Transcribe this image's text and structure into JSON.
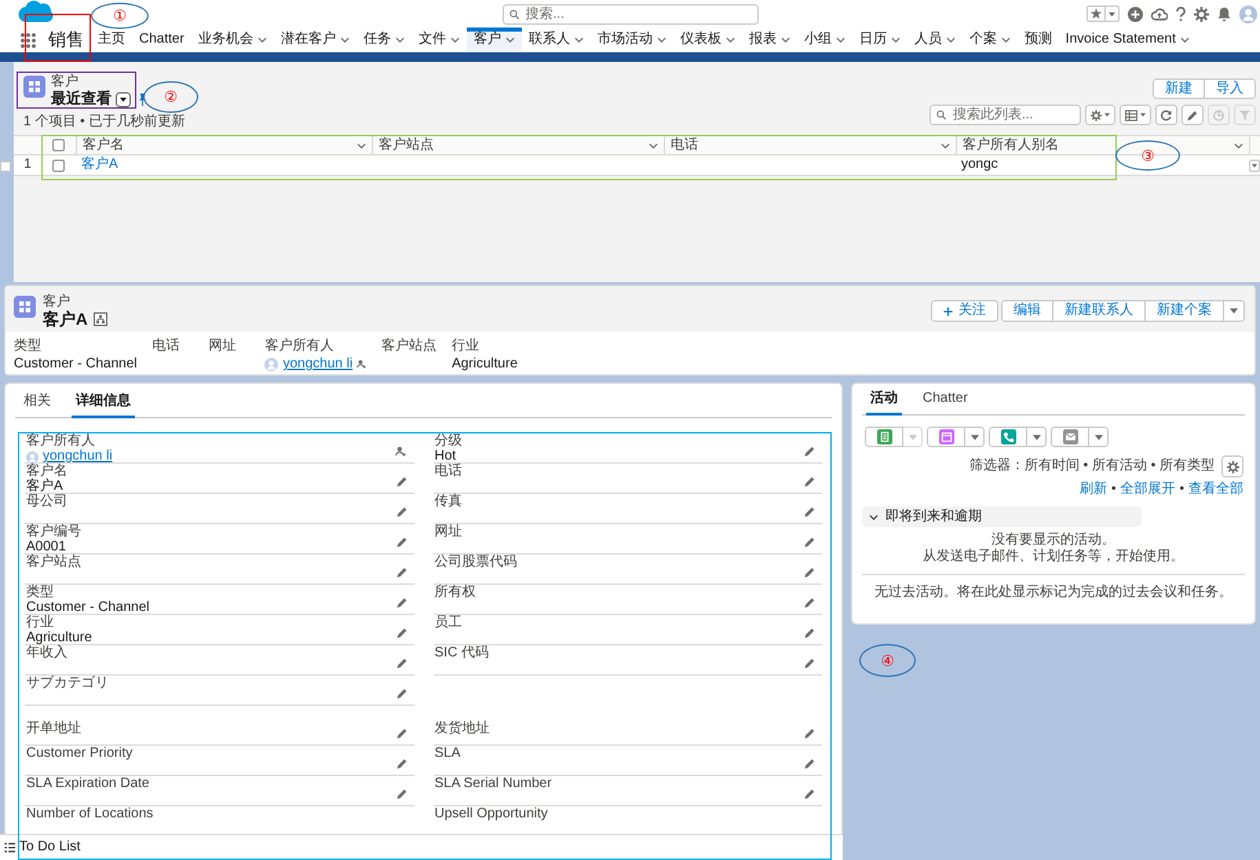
{
  "header": {
    "search": {
      "placeholder": "搜索..."
    }
  },
  "app": {
    "name": "销售"
  },
  "nav": [
    {
      "label": "主页",
      "has_menu": false,
      "selected": false
    },
    {
      "label": "Chatter",
      "has_menu": false,
      "selected": false
    },
    {
      "label": "业务机会",
      "has_menu": true,
      "selected": false
    },
    {
      "label": "潜在客户",
      "has_menu": true,
      "selected": false
    },
    {
      "label": "任务",
      "has_menu": true,
      "selected": false
    },
    {
      "label": "文件",
      "has_menu": true,
      "selected": false
    },
    {
      "label": "客户",
      "has_menu": true,
      "selected": true
    },
    {
      "label": "联系人",
      "has_menu": true,
      "selected": false
    },
    {
      "label": "市场活动",
      "has_menu": true,
      "selected": false
    },
    {
      "label": "仪表板",
      "has_menu": true,
      "selected": false
    },
    {
      "label": "报表",
      "has_menu": true,
      "selected": false
    },
    {
      "label": "小组",
      "has_menu": true,
      "selected": false
    },
    {
      "label": "日历",
      "has_menu": true,
      "selected": false
    },
    {
      "label": "人员",
      "has_menu": true,
      "selected": false
    },
    {
      "label": "个案",
      "has_menu": true,
      "selected": false
    },
    {
      "label": "预测",
      "has_menu": false,
      "selected": false
    },
    {
      "label": "Invoice Statement",
      "has_menu": true,
      "selected": false
    }
  ],
  "list_view": {
    "object_label": "客户",
    "title": "最近查看",
    "status": "1 个项目 • 已于几秒前更新",
    "buttons": [
      "新建",
      "导入"
    ],
    "search": {
      "placeholder": "搜索此列表..."
    },
    "table": {
      "select_all_checked": false,
      "columns": [
        "客户名",
        "客户站点",
        "电话",
        "客户所有人别名"
      ],
      "rows": [
        {
          "number": "1",
          "checked": false,
          "name": "客户A",
          "owner_alias": "yongc"
        }
      ]
    }
  },
  "record": {
    "object_label": "客户",
    "name": "客户A",
    "buttons": [
      {
        "label": "关注",
        "kind": "follow"
      },
      {
        "label": "编辑",
        "kind": "plain"
      },
      {
        "label": "新建联系人",
        "kind": "plain"
      },
      {
        "label": "新建个案",
        "kind": "plain"
      }
    ],
    "highlights": [
      {
        "label": "类型",
        "value": "Customer - Channel",
        "kind": "text"
      },
      {
        "label": "电话",
        "kind": "text"
      },
      {
        "label": "网址",
        "kind": "text"
      },
      {
        "label": "客户所有人",
        "value": "yongchun li",
        "kind": "user"
      },
      {
        "label": "客户站点",
        "kind": "text"
      },
      {
        "label": "行业",
        "value": "Agriculture",
        "kind": "text"
      }
    ]
  },
  "detail": {
    "tabs": [
      {
        "label": "相关",
        "selected": false
      },
      {
        "label": "详细信息",
        "selected": true
      }
    ],
    "rows": [
      {
        "fields": [
          {
            "label": "客户所有人",
            "value": "yongchun li",
            "kind": "user",
            "editable": false
          },
          {
            "label": "分级",
            "value": "Hot",
            "kind": "text",
            "editable": true
          }
        ]
      },
      {
        "fields": [
          {
            "label": "客户名",
            "value": "客户A",
            "kind": "text",
            "editable": true
          },
          {
            "label": "电话",
            "kind": "text",
            "editable": true
          }
        ]
      },
      {
        "fields": [
          {
            "label": "母公司",
            "kind": "text",
            "editable": true
          },
          {
            "label": "传真",
            "kind": "text",
            "editable": true
          }
        ]
      },
      {
        "fields": [
          {
            "label": "客户编号",
            "value": "A0001",
            "kind": "text",
            "editable": true
          },
          {
            "label": "网址",
            "kind": "text",
            "editable": true
          }
        ]
      },
      {
        "fields": [
          {
            "label": "客户站点",
            "kind": "text",
            "editable": true
          },
          {
            "label": "公司股票代码",
            "kind": "text",
            "editable": true
          }
        ]
      },
      {
        "fields": [
          {
            "label": "类型",
            "value": "Customer - Channel",
            "kind": "text",
            "editable": true
          },
          {
            "label": "所有权",
            "kind": "text",
            "editable": true
          }
        ]
      },
      {
        "fields": [
          {
            "label": "行业",
            "value": "Agriculture",
            "kind": "text",
            "editable": true
          },
          {
            "label": "员工",
            "kind": "text",
            "editable": true
          }
        ]
      },
      {
        "fields": [
          {
            "label": "年收入",
            "kind": "text",
            "editable": true
          },
          {
            "label": "SIC 代码",
            "kind": "text",
            "editable": true
          }
        ]
      },
      {
        "fields": [
          {
            "label": "サブカテゴリ",
            "kind": "text",
            "editable": true
          }
        ]
      },
      {
        "fields": [
          {
            "label": "开单地址",
            "kind": "address",
            "editable": true
          },
          {
            "label": "发货地址",
            "kind": "address",
            "editable": true
          }
        ]
      },
      {
        "fields": [
          {
            "label": "Customer Priority",
            "kind": "text",
            "editable": true
          },
          {
            "label": "SLA",
            "kind": "text",
            "editable": true
          }
        ]
      },
      {
        "fields": [
          {
            "label": "SLA Expiration Date",
            "kind": "text",
            "editable": true
          },
          {
            "label": "SLA Serial Number",
            "kind": "text",
            "editable": true
          }
        ]
      },
      {
        "fields": [
          {
            "label": "Number of Locations",
            "kind": "text",
            "editable": false
          },
          {
            "label": "Upsell Opportunity",
            "kind": "text",
            "editable": false
          }
        ]
      }
    ]
  },
  "activity": {
    "tabs": [
      {
        "label": "活动",
        "selected": true
      },
      {
        "label": "Chatter",
        "selected": false
      }
    ],
    "actions": [
      {
        "kind": "task",
        "menu_disabled": true
      },
      {
        "kind": "event",
        "menu_disabled": false
      },
      {
        "kind": "call",
        "menu_disabled": false
      },
      {
        "kind": "email",
        "menu_disabled": false
      }
    ],
    "filter": "筛选器：所有时间 • 所有活动 • 所有类型",
    "links": [
      "刷新",
      "全部展开",
      "查看全部"
    ],
    "link_separator": "•",
    "section": {
      "title": "即将到来和逾期",
      "expanded": true
    },
    "empty_messages": [
      "没有要显示的活动。",
      "从发送电子邮件、计划任务等，开始使用。"
    ],
    "past_message": "无过去活动。将在此处显示标记为完成的过去会议和任务。"
  },
  "utility_bar": {
    "items": [
      "To Do List"
    ]
  },
  "annotations": [
    {
      "label": "①",
      "color": "#ff0000"
    },
    {
      "label": "②",
      "color": "#7030a0"
    },
    {
      "label": "③",
      "color": "#92d050"
    },
    {
      "label": "④",
      "color": "#00b0f0"
    }
  ]
}
